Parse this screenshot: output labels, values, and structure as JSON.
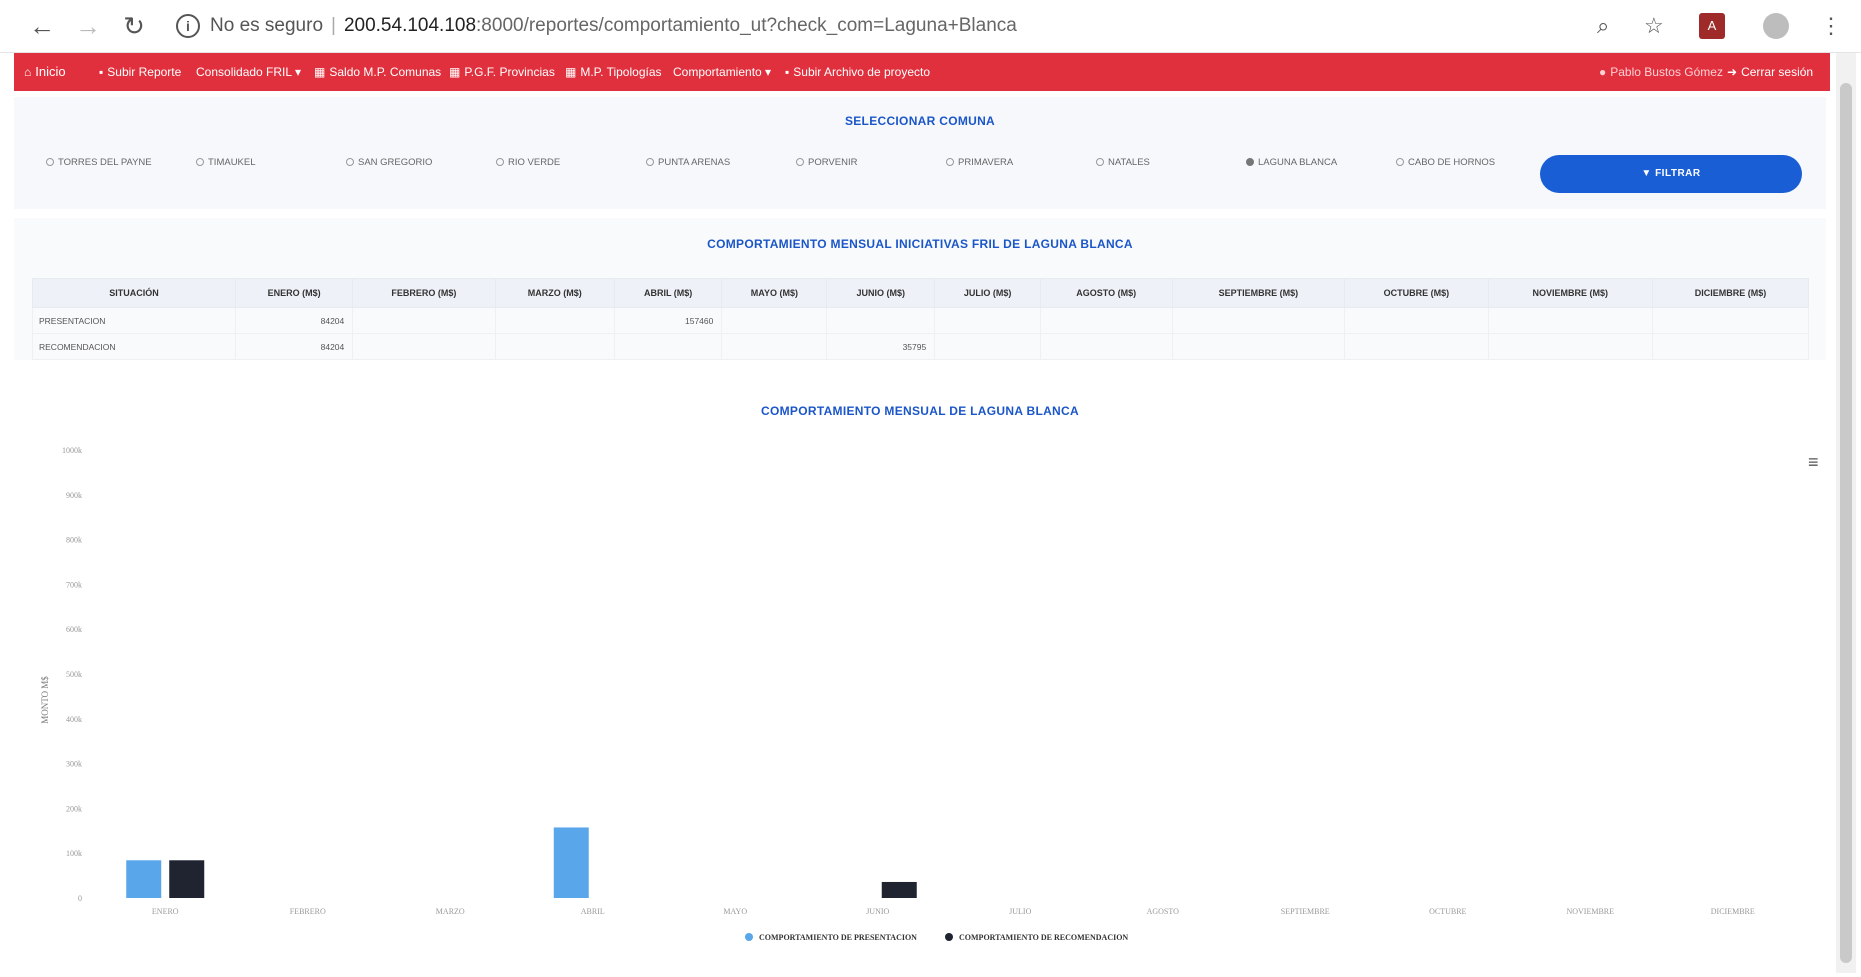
{
  "browser": {
    "security_label": "No es seguro",
    "url_host": "200.54.104.108",
    "url_path": ":8000/reportes/comportamiento_ut?check_com=Laguna+Blanca"
  },
  "nav": {
    "items": [
      {
        "label": "Inicio",
        "icon": "home-icon"
      },
      {
        "label": "Subir Reporte",
        "icon": "file-icon"
      },
      {
        "label": "Consolidado FRIL ▾",
        "icon": ""
      },
      {
        "label": "Saldo M.P. Comunas",
        "icon": "table-icon"
      },
      {
        "label": "P.G.F. Provincias",
        "icon": "table-icon"
      },
      {
        "label": "M.P. Tipologías",
        "icon": "table-icon"
      },
      {
        "label": "Comportamiento ▾",
        "icon": ""
      },
      {
        "label": "Subir Archivo de proyecto",
        "icon": "file-icon"
      }
    ],
    "user_label": "Pablo Bustos Gómez",
    "logout_label": "Cerrar sesión",
    "color": "#e0303e"
  },
  "filter": {
    "title": "SELECCIONAR COMUNA",
    "options": [
      "TORRES DEL PAYNE",
      "TIMAUKEL",
      "SAN GREGORIO",
      "RIO VERDE",
      "PUNTA ARENAS",
      "PORVENIR",
      "PRIMAVERA",
      "NATALES",
      "LAGUNA BLANCA",
      "CABO DE HORNOS"
    ],
    "selected": "LAGUNA BLANCA",
    "button_label": "FILTRAR"
  },
  "table": {
    "title": "COMPORTAMIENTO MENSUAL INICIATIVAS FRIL DE LAGUNA BLANCA",
    "headers": [
      "SITUACIÓN",
      "ENERO (M$)",
      "FEBRERO (M$)",
      "MARZO (M$)",
      "ABRIL (M$)",
      "MAYO (M$)",
      "JUNIO (M$)",
      "JULIO (M$)",
      "AGOSTO (M$)",
      "SEPTIEMBRE (M$)",
      "OCTUBRE (M$)",
      "NOVIEMBRE (M$)",
      "DICIEMBRE (M$)"
    ],
    "rows": [
      [
        "PRESENTACION",
        "84204",
        "",
        "",
        "157460",
        "",
        "",
        "",
        "",
        "",
        "",
        "",
        ""
      ],
      [
        "RECOMENDACION",
        "84204",
        "",
        "",
        "",
        "",
        "35795",
        "",
        "",
        "",
        "",
        "",
        ""
      ]
    ]
  },
  "chart_data": {
    "type": "bar",
    "title": "COMPORTAMIENTO MENSUAL DE LAGUNA BLANCA",
    "ylabel": "MONTO M$",
    "categories": [
      "ENERO",
      "FEBRERO",
      "MARZO",
      "ABRIL",
      "MAYO",
      "JUNIO",
      "JULIO",
      "AGOSTO",
      "SEPTIEMBRE",
      "OCTUBRE",
      "NOVIEMBRE",
      "DICIEMBRE"
    ],
    "series": [
      {
        "name": "COMPORTAMIENTO DE PRESENTACION",
        "color": "#5aa6ea",
        "values": [
          84204,
          0,
          0,
          157460,
          0,
          0,
          0,
          0,
          0,
          0,
          0,
          0
        ]
      },
      {
        "name": "COMPORTAMIENTO DE RECOMENDACION",
        "color": "#1f2430",
        "values": [
          84204,
          0,
          0,
          0,
          0,
          35795,
          0,
          0,
          0,
          0,
          0,
          0
        ]
      }
    ],
    "ylim": [
      0,
      1000000
    ],
    "yticks": [
      "0",
      "100k",
      "200k",
      "300k",
      "400k",
      "500k",
      "600k",
      "700k",
      "800k",
      "900k",
      "1000k"
    ],
    "legend": "bottom",
    "grid": false
  }
}
